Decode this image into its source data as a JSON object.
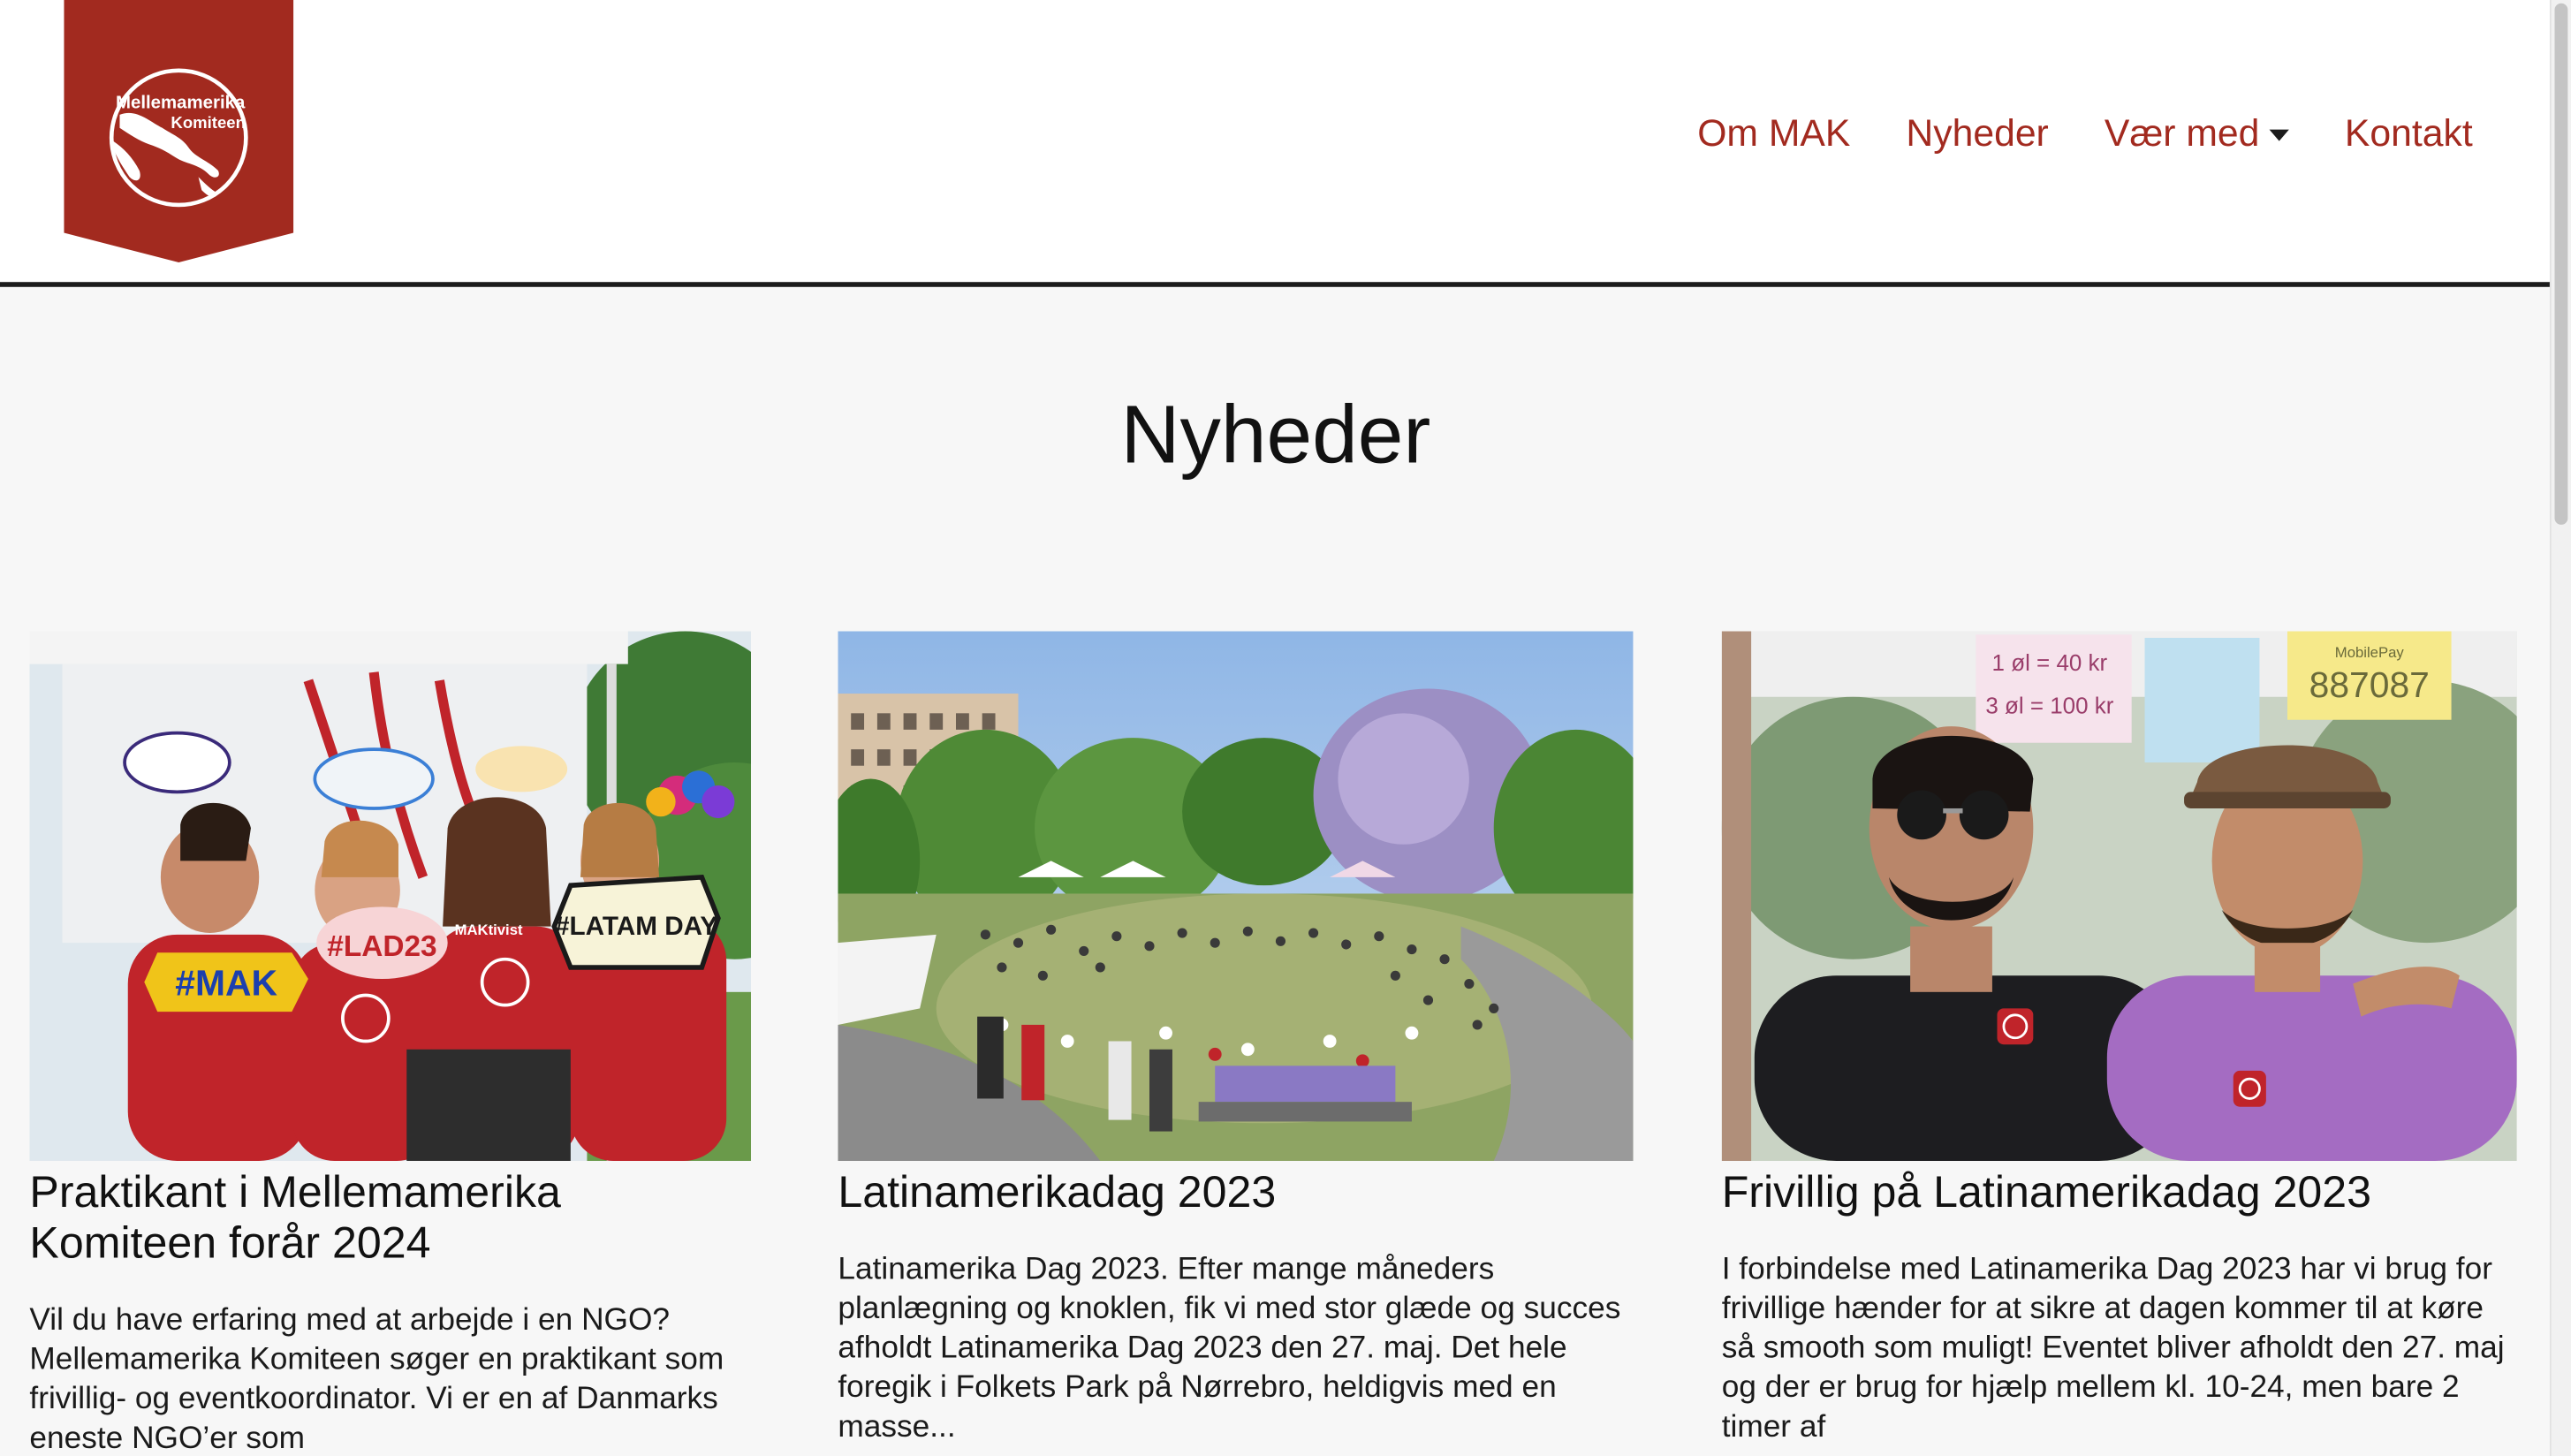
{
  "header": {
    "logo": {
      "line1": "Mellemamerika",
      "line2": "Komiteen",
      "color": "#a22a1f"
    },
    "nav": [
      {
        "label": "Om MAK"
      },
      {
        "label": "Nyheder"
      },
      {
        "label": "Vær med",
        "has_dropdown": true,
        "icon": "caret-down-icon"
      },
      {
        "label": "Kontakt"
      }
    ],
    "accent_color": "#a22a1f"
  },
  "page": {
    "title": "Nyheder"
  },
  "articles": [
    {
      "image_desc": "volunteers-photo-booth",
      "sign_texts": [
        "#MAK",
        "#LAD23",
        "#LATAM DAY",
        "MAKtivist"
      ],
      "title": "Praktikant i Mellemamerika Komiteen forår 2024",
      "excerpt": "Vil du have erfaring med at arbejde i en NGO? Mellemamerika Komiteen søger en praktikant som frivillig- og eventkoordinator. Vi er en af Danmarks eneste NGO’er som"
    },
    {
      "image_desc": "park-festival-crowd",
      "title": "Latinamerikadag 2023",
      "excerpt": "Latinamerika Dag 2023. Efter mange måneders planlægning og knoklen, fik vi med stor glæde og succes afholdt Latinamerika Dag 2023 den 27. maj. Det hele foregik i Folkets Park på Nørrebro, heldigvis med en masse..."
    },
    {
      "image_desc": "two-volunteers-portrait",
      "sign_texts": [
        "1 øl = 40 kr",
        "3 øl = 100 kr",
        "887087",
        "MobilePay"
      ],
      "title": "Frivillig på Latinamerikadag 2023",
      "excerpt": "I forbindelse med Latinamerika Dag 2023 har vi brug for frivillige hænder for at sikre at dagen kommer til at køre så smooth som muligt! Eventet bliver afholdt den 27. maj og der er brug for hjælp mellem kl. 10-24, men bare 2 timer af"
    }
  ]
}
